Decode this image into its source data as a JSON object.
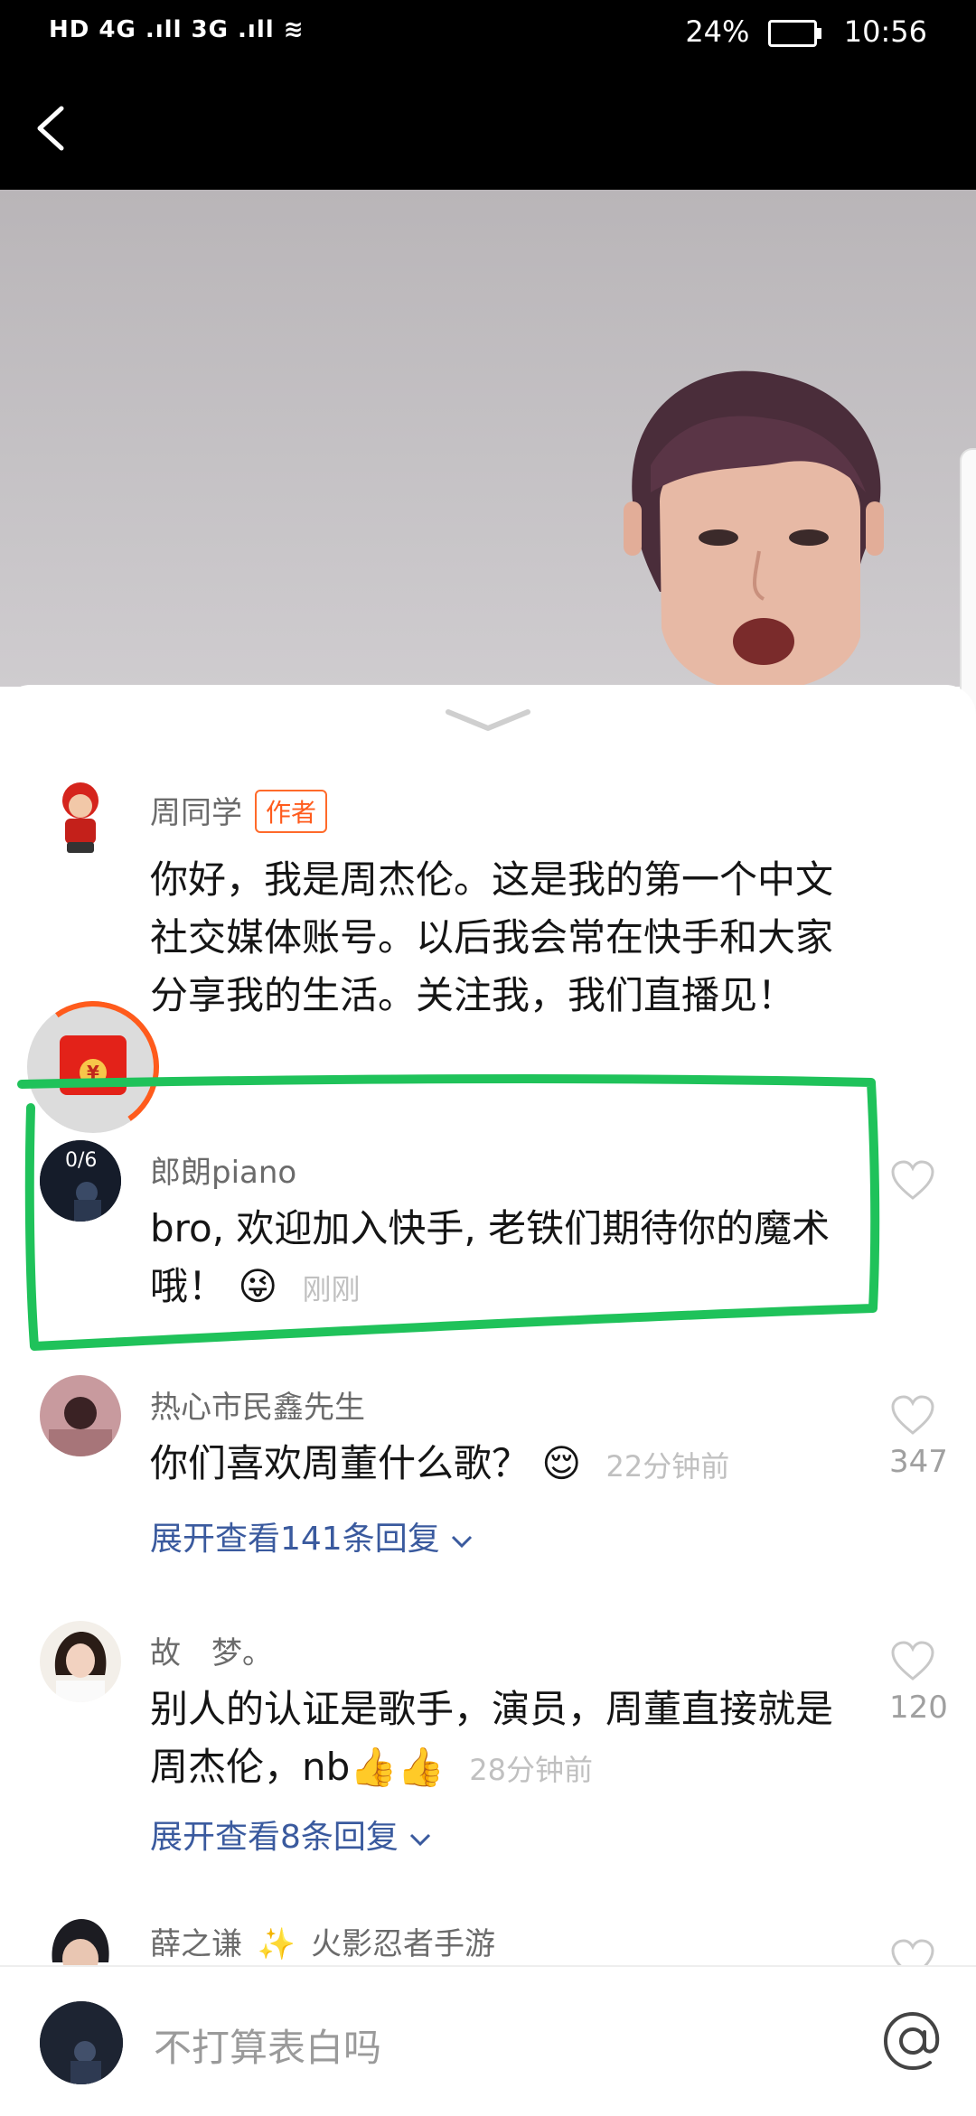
{
  "status_bar": {
    "left_indicators": "HD 4G .ıll 3G .ıll ≋",
    "battery": "24%",
    "time": "10:56"
  },
  "comments": [
    {
      "username": "周同学",
      "badge": "作者",
      "text": "你好，我是周杰伦。这是我的第一个中文社交媒体账号。以后我会常在快手和大家分享我的生活。关注我，我们直播见！"
    },
    {
      "username": "郎朗piano",
      "avatar_overlay": "0/6",
      "text": "bro, 欢迎加入快手, 老铁们期待你的魔术哦！",
      "emoji": "😜",
      "time": "刚刚"
    },
    {
      "username": "热心市民鑫先生",
      "text": "你们喜欢周董什么歌？",
      "emoji": "😌",
      "time": "22分钟前",
      "likes": "347",
      "expand": "展开查看141条回复"
    },
    {
      "username": "故　梦。",
      "text": "别人的认证是歌手，演员，周董直接就是周杰伦，nb",
      "emoji": "👍👍",
      "time": "28分钟前",
      "likes": "120",
      "expand": "展开查看8条回复"
    },
    {
      "username": "薛之谦",
      "badge_icon": "sparkle-icon",
      "extra": "火影忍者手游"
    }
  ],
  "redpacket_symbol": "¥",
  "input": {
    "placeholder": "不打算表白吗"
  },
  "colors": {
    "accent_orange": "#ff5b1c",
    "link_blue": "#3a5a9e",
    "highlight_green": "#1fc25a"
  }
}
